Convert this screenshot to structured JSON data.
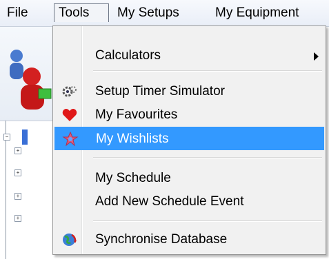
{
  "menubar": {
    "items": [
      "File",
      "Tools",
      "My Setups",
      "My Equipment"
    ]
  },
  "tools_menu": {
    "calculators": "Calculators",
    "setup_timer": "Setup Timer Simulator",
    "favourites": "My Favourites",
    "wishlists": "My Wishlists",
    "schedule": "My Schedule",
    "add_event": "Add New Schedule Event",
    "sync": "Synchronise Database"
  },
  "colors": {
    "highlight": "#3399ff",
    "heart": "#e01818"
  },
  "icons": {
    "setup_timer": "gear-timer-icon",
    "favourites": "heart-icon",
    "wishlists": "star-icon",
    "sync": "globe-sync-icon"
  }
}
